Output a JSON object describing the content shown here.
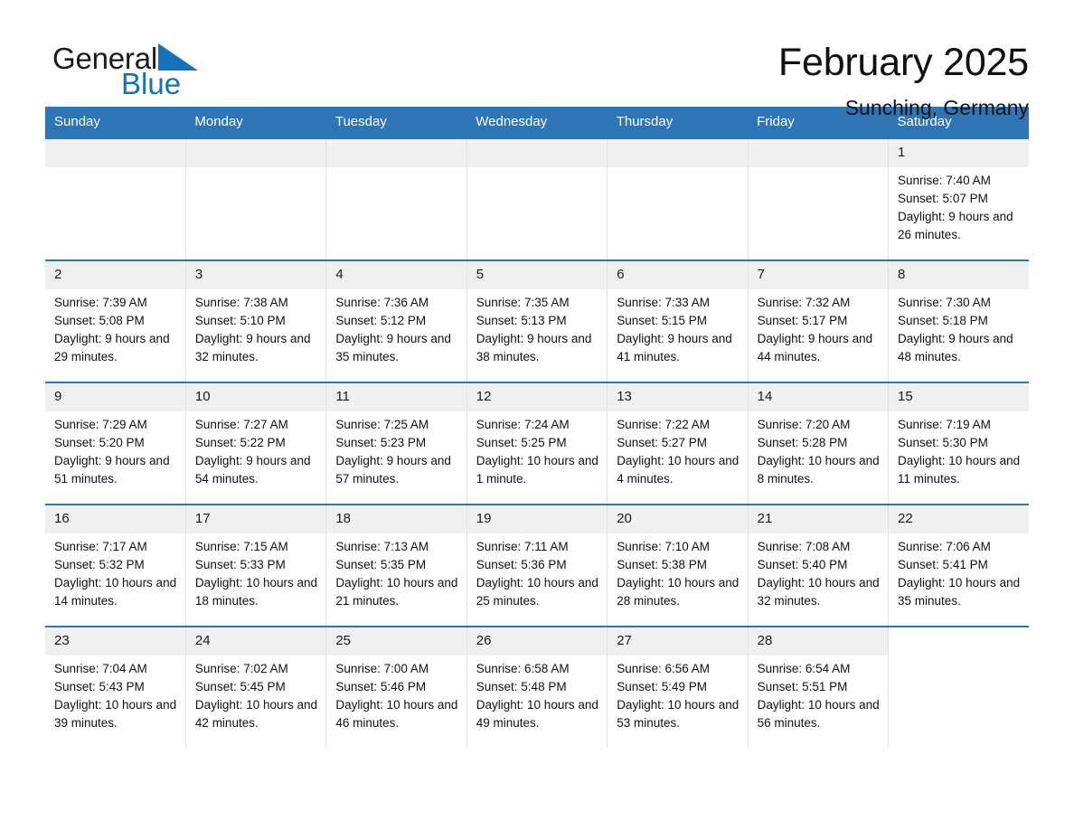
{
  "brand": {
    "name_part1": "General",
    "name_part2": "Blue",
    "accent_color": "#1472b8"
  },
  "header": {
    "title": "February 2025",
    "subtitle": "Sunching, Germany"
  },
  "theme": {
    "header_bg": "#2e75b6",
    "daynum_bg": "#f0f0f0",
    "row_border": "#2e75b6"
  },
  "weekday_headers": [
    "Sunday",
    "Monday",
    "Tuesday",
    "Wednesday",
    "Thursday",
    "Friday",
    "Saturday"
  ],
  "labels": {
    "sunrise_prefix": "Sunrise:",
    "sunset_prefix": "Sunset:",
    "daylight_prefix": "Daylight:"
  },
  "weeks": [
    [
      {
        "day": "",
        "empty": true
      },
      {
        "day": "",
        "empty": true
      },
      {
        "day": "",
        "empty": true
      },
      {
        "day": "",
        "empty": true
      },
      {
        "day": "",
        "empty": true
      },
      {
        "day": "",
        "empty": true
      },
      {
        "day": "1",
        "sunrise": "Sunrise: 7:40 AM",
        "sunset": "Sunset: 5:07 PM",
        "daylight": "Daylight: 9 hours and 26 minutes."
      }
    ],
    [
      {
        "day": "2",
        "sunrise": "Sunrise: 7:39 AM",
        "sunset": "Sunset: 5:08 PM",
        "daylight": "Daylight: 9 hours and 29 minutes."
      },
      {
        "day": "3",
        "sunrise": "Sunrise: 7:38 AM",
        "sunset": "Sunset: 5:10 PM",
        "daylight": "Daylight: 9 hours and 32 minutes."
      },
      {
        "day": "4",
        "sunrise": "Sunrise: 7:36 AM",
        "sunset": "Sunset: 5:12 PM",
        "daylight": "Daylight: 9 hours and 35 minutes."
      },
      {
        "day": "5",
        "sunrise": "Sunrise: 7:35 AM",
        "sunset": "Sunset: 5:13 PM",
        "daylight": "Daylight: 9 hours and 38 minutes."
      },
      {
        "day": "6",
        "sunrise": "Sunrise: 7:33 AM",
        "sunset": "Sunset: 5:15 PM",
        "daylight": "Daylight: 9 hours and 41 minutes."
      },
      {
        "day": "7",
        "sunrise": "Sunrise: 7:32 AM",
        "sunset": "Sunset: 5:17 PM",
        "daylight": "Daylight: 9 hours and 44 minutes."
      },
      {
        "day": "8",
        "sunrise": "Sunrise: 7:30 AM",
        "sunset": "Sunset: 5:18 PM",
        "daylight": "Daylight: 9 hours and 48 minutes."
      }
    ],
    [
      {
        "day": "9",
        "sunrise": "Sunrise: 7:29 AM",
        "sunset": "Sunset: 5:20 PM",
        "daylight": "Daylight: 9 hours and 51 minutes."
      },
      {
        "day": "10",
        "sunrise": "Sunrise: 7:27 AM",
        "sunset": "Sunset: 5:22 PM",
        "daylight": "Daylight: 9 hours and 54 minutes."
      },
      {
        "day": "11",
        "sunrise": "Sunrise: 7:25 AM",
        "sunset": "Sunset: 5:23 PM",
        "daylight": "Daylight: 9 hours and 57 minutes."
      },
      {
        "day": "12",
        "sunrise": "Sunrise: 7:24 AM",
        "sunset": "Sunset: 5:25 PM",
        "daylight": "Daylight: 10 hours and 1 minute."
      },
      {
        "day": "13",
        "sunrise": "Sunrise: 7:22 AM",
        "sunset": "Sunset: 5:27 PM",
        "daylight": "Daylight: 10 hours and 4 minutes."
      },
      {
        "day": "14",
        "sunrise": "Sunrise: 7:20 AM",
        "sunset": "Sunset: 5:28 PM",
        "daylight": "Daylight: 10 hours and 8 minutes."
      },
      {
        "day": "15",
        "sunrise": "Sunrise: 7:19 AM",
        "sunset": "Sunset: 5:30 PM",
        "daylight": "Daylight: 10 hours and 11 minutes."
      }
    ],
    [
      {
        "day": "16",
        "sunrise": "Sunrise: 7:17 AM",
        "sunset": "Sunset: 5:32 PM",
        "daylight": "Daylight: 10 hours and 14 minutes."
      },
      {
        "day": "17",
        "sunrise": "Sunrise: 7:15 AM",
        "sunset": "Sunset: 5:33 PM",
        "daylight": "Daylight: 10 hours and 18 minutes."
      },
      {
        "day": "18",
        "sunrise": "Sunrise: 7:13 AM",
        "sunset": "Sunset: 5:35 PM",
        "daylight": "Daylight: 10 hours and 21 minutes."
      },
      {
        "day": "19",
        "sunrise": "Sunrise: 7:11 AM",
        "sunset": "Sunset: 5:36 PM",
        "daylight": "Daylight: 10 hours and 25 minutes."
      },
      {
        "day": "20",
        "sunrise": "Sunrise: 7:10 AM",
        "sunset": "Sunset: 5:38 PM",
        "daylight": "Daylight: 10 hours and 28 minutes."
      },
      {
        "day": "21",
        "sunrise": "Sunrise: 7:08 AM",
        "sunset": "Sunset: 5:40 PM",
        "daylight": "Daylight: 10 hours and 32 minutes."
      },
      {
        "day": "22",
        "sunrise": "Sunrise: 7:06 AM",
        "sunset": "Sunset: 5:41 PM",
        "daylight": "Daylight: 10 hours and 35 minutes."
      }
    ],
    [
      {
        "day": "23",
        "sunrise": "Sunrise: 7:04 AM",
        "sunset": "Sunset: 5:43 PM",
        "daylight": "Daylight: 10 hours and 39 minutes."
      },
      {
        "day": "24",
        "sunrise": "Sunrise: 7:02 AM",
        "sunset": "Sunset: 5:45 PM",
        "daylight": "Daylight: 10 hours and 42 minutes."
      },
      {
        "day": "25",
        "sunrise": "Sunrise: 7:00 AM",
        "sunset": "Sunset: 5:46 PM",
        "daylight": "Daylight: 10 hours and 46 minutes."
      },
      {
        "day": "26",
        "sunrise": "Sunrise: 6:58 AM",
        "sunset": "Sunset: 5:48 PM",
        "daylight": "Daylight: 10 hours and 49 minutes."
      },
      {
        "day": "27",
        "sunrise": "Sunrise: 6:56 AM",
        "sunset": "Sunset: 5:49 PM",
        "daylight": "Daylight: 10 hours and 53 minutes."
      },
      {
        "day": "28",
        "sunrise": "Sunrise: 6:54 AM",
        "sunset": "Sunset: 5:51 PM",
        "daylight": "Daylight: 10 hours and 56 minutes."
      },
      {
        "day": "",
        "blank": true
      }
    ]
  ]
}
